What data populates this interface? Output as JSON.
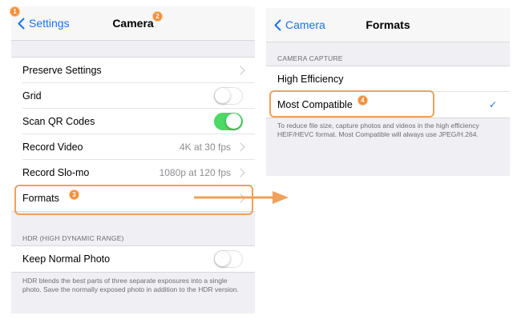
{
  "colors": {
    "accent": "#1a73e8",
    "toggle_on": "#4cd964",
    "annotation": "#f0a15a"
  },
  "left": {
    "back_label": "Settings",
    "title": "Camera",
    "rows": [
      {
        "label": "Preserve Settings",
        "detail": "",
        "control": "chevron"
      },
      {
        "label": "Grid",
        "detail": "",
        "control": "toggle-off"
      },
      {
        "label": "Scan QR Codes",
        "detail": "",
        "control": "toggle-on"
      },
      {
        "label": "Record Video",
        "detail": "4K at 30 fps",
        "control": "chevron"
      },
      {
        "label": "Record Slo-mo",
        "detail": "1080p at 120 fps",
        "control": "chevron"
      },
      {
        "label": "Formats",
        "detail": "",
        "control": "chevron"
      }
    ],
    "hdr_header": "HDR (HIGH DYNAMIC RANGE)",
    "hdr_row": {
      "label": "Keep Normal Photo",
      "control": "toggle-off"
    },
    "hdr_footer": "HDR blends the best parts of three separate exposures into a single photo. Save the normally exposed photo in addition to the HDR version."
  },
  "right": {
    "back_label": "Camera",
    "title": "Formats",
    "section_header": "CAMERA CAPTURE",
    "options": [
      {
        "label": "High Efficiency",
        "selected": false
      },
      {
        "label": "Most Compatible",
        "selected": true
      }
    ],
    "checkmark": "✓",
    "footer": "To reduce file size, capture photos and videos in the high efficiency HEIF/HEVC format. Most Compatible will always use JPEG/H.264."
  },
  "annotations": {
    "badge_1": "1",
    "badge_2": "2",
    "badge_3": "3",
    "badge_4": "4"
  }
}
